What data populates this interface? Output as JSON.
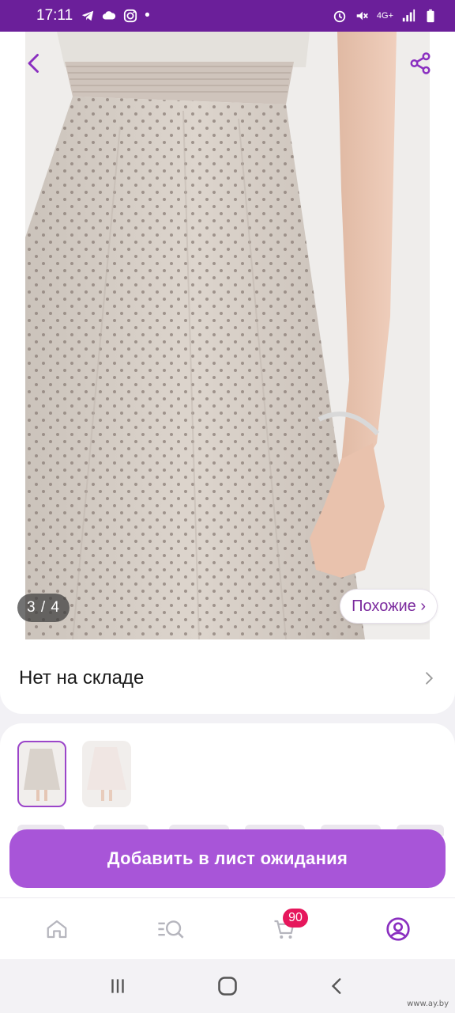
{
  "status_bar": {
    "time": "17:11",
    "dot": "•",
    "network": "4G+",
    "icons": [
      "telegram-icon",
      "cloud-icon",
      "instagram-icon",
      "alarm-icon",
      "mute-icon",
      "signal-icon",
      "battery-icon"
    ]
  },
  "gallery": {
    "counter": "3 / 4",
    "similar_label": "Похожие ›"
  },
  "stock": {
    "status": "Нет на складе"
  },
  "actions": {
    "waitlist_label": "Добавить в лист ожидания"
  },
  "bottom_nav": {
    "cart_count": "90",
    "items": [
      "home-icon",
      "catalog-search-icon",
      "cart-icon",
      "profile-icon"
    ]
  },
  "watermark": "www.ay.by",
  "colors": {
    "status_bar": "#6b1f9a",
    "accent": "#a855d8",
    "badge": "#e6175c",
    "icon_purple": "#8a2fc0"
  }
}
